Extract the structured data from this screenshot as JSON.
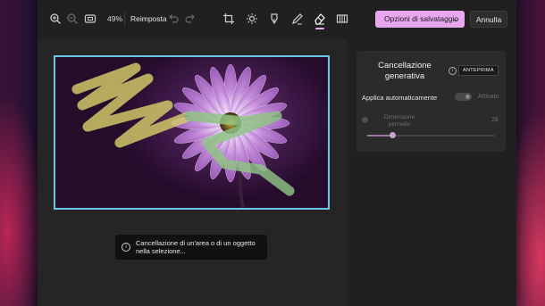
{
  "toolbar": {
    "zoom_value": "49%",
    "reset_label": "Reimposta",
    "save_label": "Opzioni di salvataggio",
    "cancel_label": "Annulla",
    "icons": [
      "zoom-in-icon",
      "zoom-out-icon",
      "fit-screen-icon",
      "undo-icon",
      "redo-icon",
      "crop-icon",
      "brightness-icon",
      "markup-icon",
      "draw-icon",
      "eraser-icon",
      "background-icon"
    ]
  },
  "colors": {
    "accent": "#e8a6ef",
    "selection_border": "#6cc7e6",
    "window_bg": "#202020",
    "panel_bg": "#2b2b2b"
  },
  "panel": {
    "title": "Cancellazione generativa",
    "preview_badge": "ANTEPRIMA",
    "auto_apply_label": "Applica automaticamente",
    "auto_apply_state": "Attivato",
    "brush_size_label": "Dimensione pennello",
    "brush_size_value": "28",
    "brush_size_fraction": 0.2
  },
  "toast": {
    "message": "Cancellazione di un'area o di un oggetto nella selezione..."
  }
}
